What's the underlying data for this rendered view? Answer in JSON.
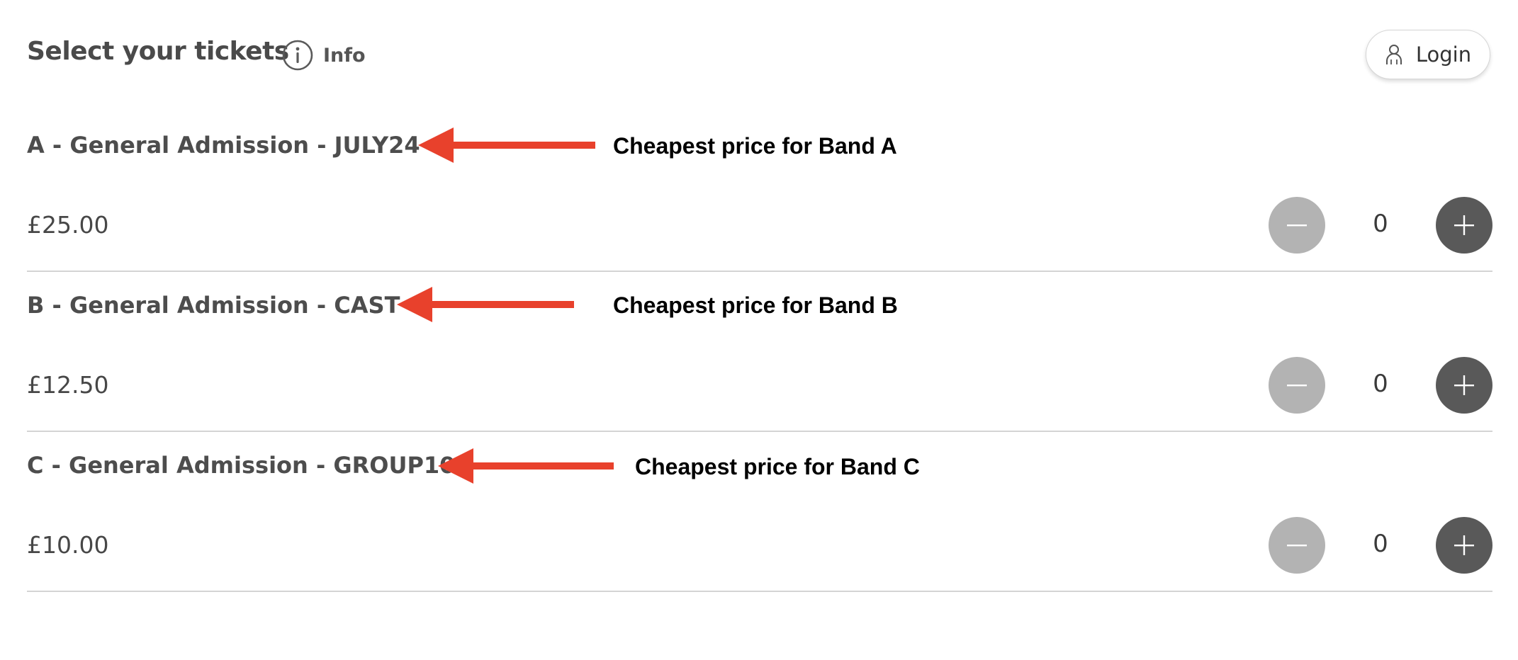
{
  "header": {
    "title": "Select your tickets",
    "info_label": "Info",
    "login_label": "Login"
  },
  "bands": [
    {
      "title": "A - General Admission - JULY24",
      "price": "£25.00",
      "quantity": "0",
      "annotation": "Cheapest price for Band A"
    },
    {
      "title": "B - General Admission - CAST",
      "price": "£12.50",
      "quantity": "0",
      "annotation": "Cheapest price for Band B"
    },
    {
      "title": "C - General Admission - GROUP10",
      "price": "£10.00",
      "quantity": "0",
      "annotation": "Cheapest price for Band C"
    }
  ],
  "icons": {
    "info": "info-circle-icon",
    "login": "user-icon",
    "decrease": "minus-icon",
    "increase": "plus-icon",
    "annotation": "arrow-left-icon"
  },
  "colors": {
    "minus_button": "#b3b3b3",
    "plus_button": "#595959",
    "annotation_arrow": "#e8412c",
    "divider": "#d4d4d4"
  }
}
